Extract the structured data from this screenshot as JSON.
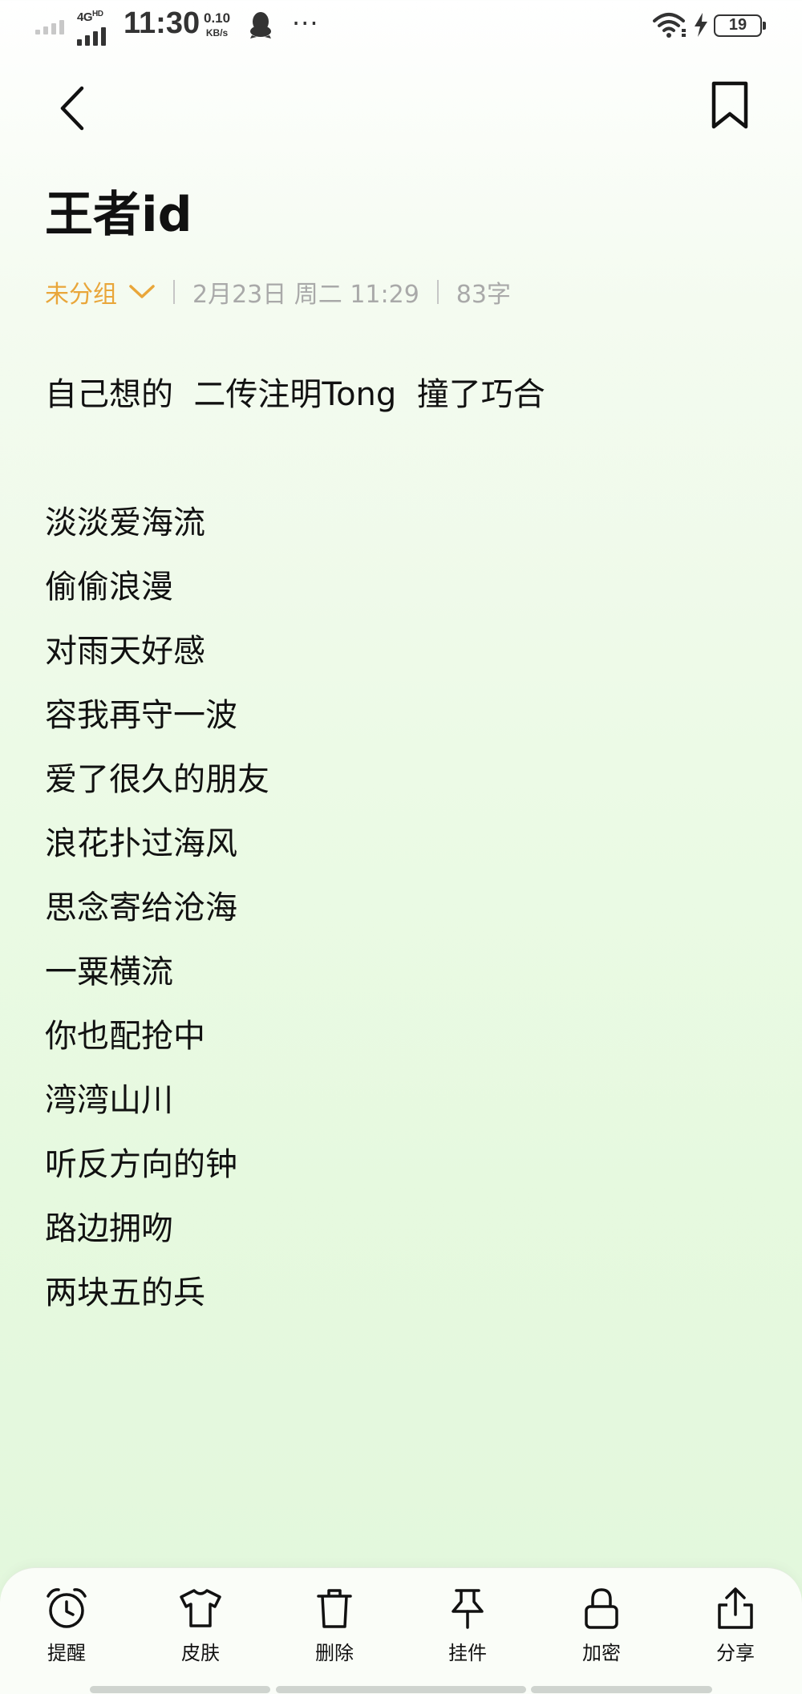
{
  "status_bar": {
    "network": "4G",
    "network_suffix": "HD",
    "time": "11:30",
    "speed_value": "0.10",
    "speed_unit": "KB/s",
    "battery": "19",
    "icons": [
      "signal-icon",
      "qq-icon",
      "more-icon",
      "wifi-icon",
      "charging-icon",
      "battery-icon"
    ]
  },
  "header": {
    "back_icon": "chevron-left-icon",
    "bookmark_icon": "bookmark-icon"
  },
  "note": {
    "title": "王者id",
    "group": "未分组",
    "date": "2月23日 周二 11:29",
    "word_count": "83字",
    "intro": "自己想的  二传注明Tong  撞了巧合",
    "lines": [
      "淡淡爱海流",
      "偷偷浪漫",
      "对雨天好感",
      "容我再守一波",
      "爱了很久的朋友",
      "浪花扑过海风",
      "思念寄给沧海",
      "一粟横流",
      "你也配抢中",
      "湾湾山川",
      "听反方向的钟",
      "路边拥吻",
      "两块五的兵"
    ]
  },
  "toolbar": {
    "reminder": "提醒",
    "skin": "皮肤",
    "delete": "删除",
    "pin": "挂件",
    "encrypt": "加密",
    "share": "分享"
  },
  "colors": {
    "accent": "#e9a63a",
    "meta_text": "#a9a9a9",
    "text": "#111111"
  }
}
